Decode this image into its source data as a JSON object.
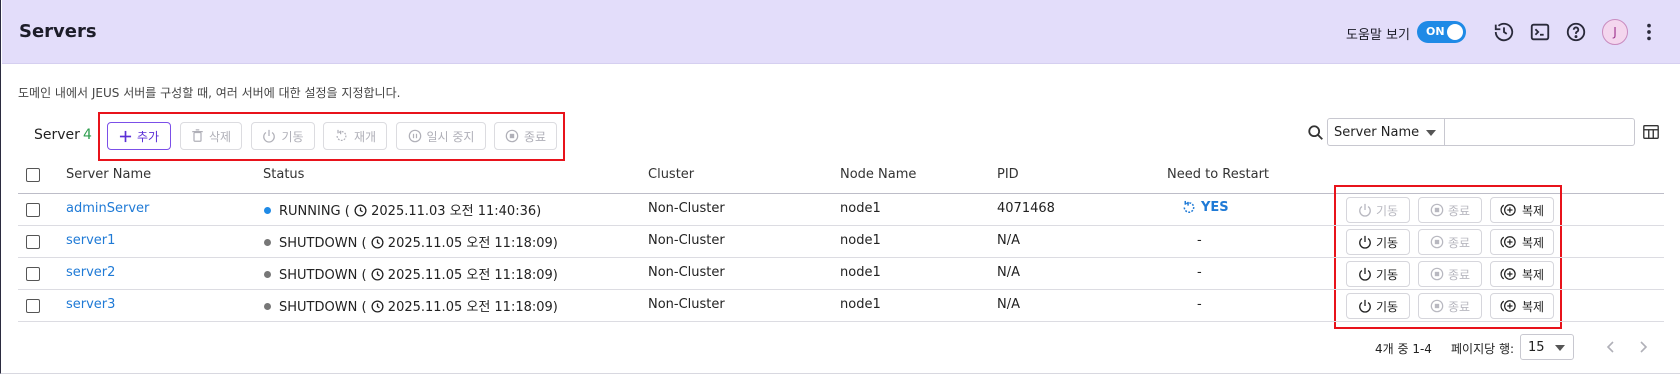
{
  "header": {
    "title": "Servers",
    "help_label": "도움말 보기",
    "help_toggle": "ON",
    "avatar_initial": "J",
    "icons": [
      "history-icon",
      "terminal-icon",
      "help-icon",
      "more-vert-icon"
    ]
  },
  "description": "도메인 내에서 JEUS 서버를 구성할 때, 여러 서버에 대한 설정을 지정합니다.",
  "toolbar": {
    "count_label": "Server",
    "count_value": "4",
    "add": "추가",
    "delete": "삭제",
    "start": "기동",
    "resume": "재개",
    "suspend": "일시 중지",
    "stop": "종료"
  },
  "search": {
    "field": "Server Name",
    "value": ""
  },
  "table": {
    "columns": [
      "Server Name",
      "Status",
      "Cluster",
      "Node Name",
      "PID",
      "Need to Restart"
    ],
    "rows": [
      {
        "name": "adminServer",
        "status": "RUNNING",
        "time": "2025.11.03 오전 11:40:36)",
        "cluster": "Non-Cluster",
        "node": "node1",
        "pid": "4071468",
        "restart": "YES",
        "status_color": "#1f8ae6"
      },
      {
        "name": "server1",
        "status": "SHUTDOWN",
        "time": "2025.11.05 오전 11:18:09)",
        "cluster": "Non-Cluster",
        "node": "node1",
        "pid": "N/A",
        "restart": "-",
        "status_color": "#777777"
      },
      {
        "name": "server2",
        "status": "SHUTDOWN",
        "time": "2025.11.05 오전 11:18:09)",
        "cluster": "Non-Cluster",
        "node": "node1",
        "pid": "N/A",
        "restart": "-",
        "status_color": "#777777"
      },
      {
        "name": "server3",
        "status": "SHUTDOWN",
        "time": "2025.11.05 오전 11:18:09)",
        "cluster": "Non-Cluster",
        "node": "node1",
        "pid": "N/A",
        "restart": "-",
        "status_color": "#777777"
      }
    ],
    "row_actions": {
      "start": "기동",
      "stop": "종료",
      "clone": "복제"
    }
  },
  "footer": {
    "range": "4개 중 1-4",
    "rows_per_page_label": "페이지당 행:",
    "rows_per_page": "15"
  },
  "colors": {
    "accent": "#5b2fd6",
    "link": "#1f7ad6",
    "highlight_box": "#e8131b",
    "header_bg": "#e3ddfa"
  }
}
